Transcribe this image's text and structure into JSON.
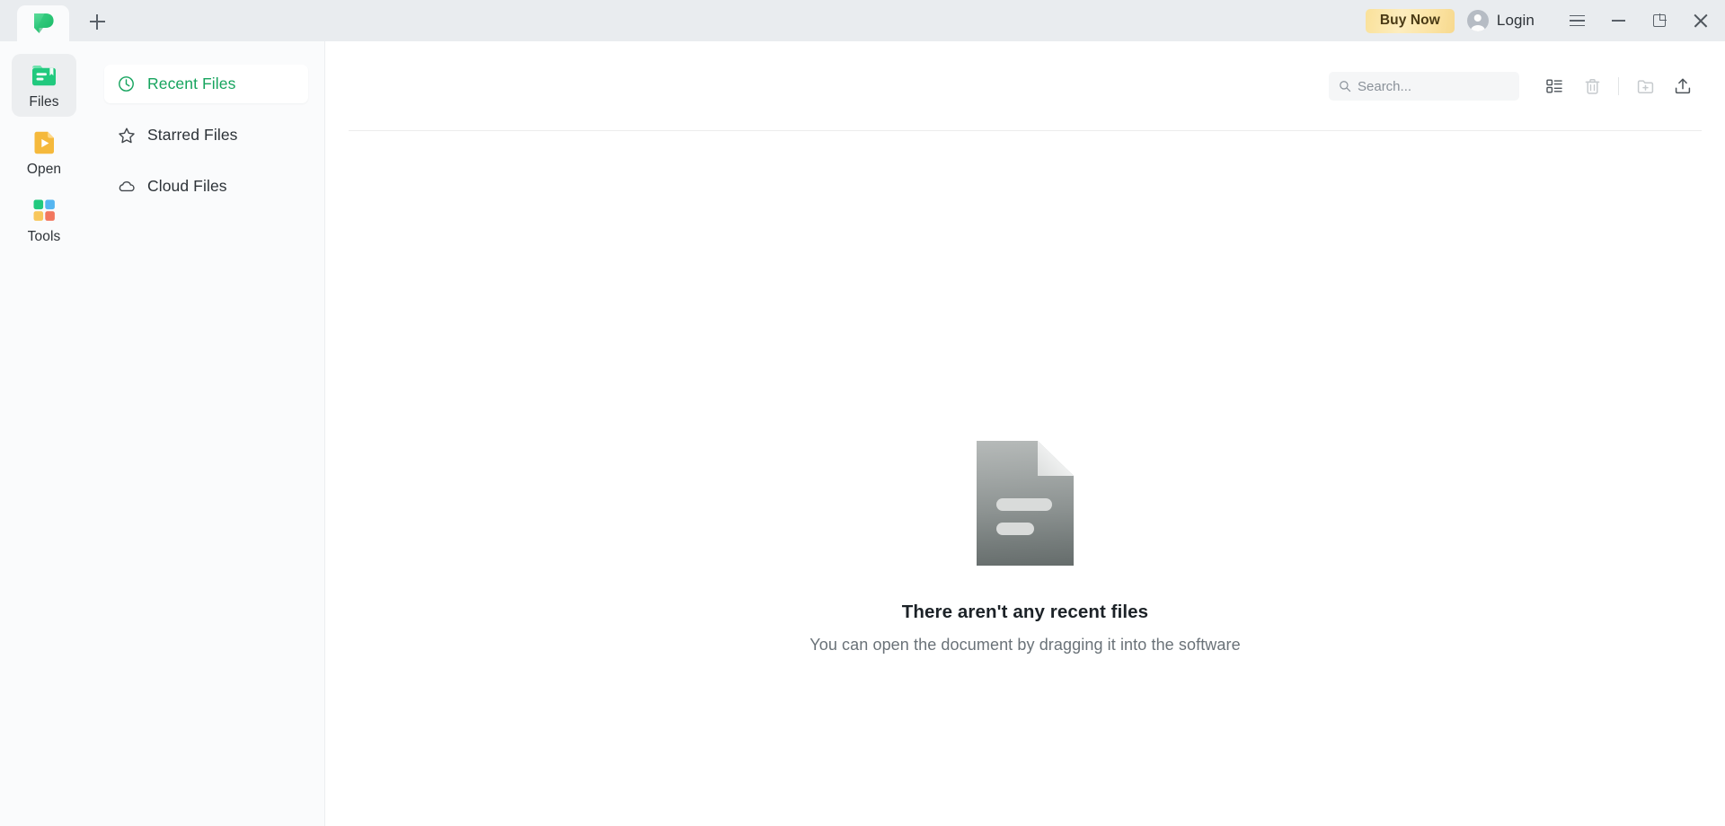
{
  "titlebar": {
    "logo_icon": "app-logo-green-p",
    "new_tab_icon": "plus-icon",
    "buy_now_label": "Buy Now",
    "login_label": "Login",
    "avatar_icon": "user-avatar-icon",
    "menu_icon": "hamburger-menu-icon",
    "minimize_icon": "minimize-icon",
    "restore_icon": "restore-icon",
    "close_icon": "close-icon",
    "bg_color": "#e9ecef"
  },
  "rail": {
    "items": [
      {
        "label": "Files",
        "icon": "files-icon",
        "active": true,
        "color": "#21c97e"
      },
      {
        "label": "Open",
        "icon": "open-icon",
        "active": false,
        "color": "#f5b93c"
      },
      {
        "label": "Tools",
        "icon": "tools-icon",
        "active": false,
        "color": "#21c97e"
      }
    ]
  },
  "nav": {
    "items": [
      {
        "label": "Recent Files",
        "icon": "clock-icon",
        "active": true
      },
      {
        "label": "Starred Files",
        "icon": "star-icon",
        "active": false
      },
      {
        "label": "Cloud Files",
        "icon": "cloud-icon",
        "active": false
      }
    ],
    "active_color": "#16a45e"
  },
  "toolbar": {
    "search_placeholder": "Search...",
    "search_value": "",
    "search_icon": "search-icon",
    "view_toggle_icon": "list-view-icon",
    "trash_icon": "trash-icon",
    "new_folder_icon": "new-folder-icon",
    "upload_icon": "upload-icon"
  },
  "empty_state": {
    "illustration": "document-icon",
    "title": "There aren't any recent files",
    "subtitle": "You can open the document by dragging it into the software"
  }
}
